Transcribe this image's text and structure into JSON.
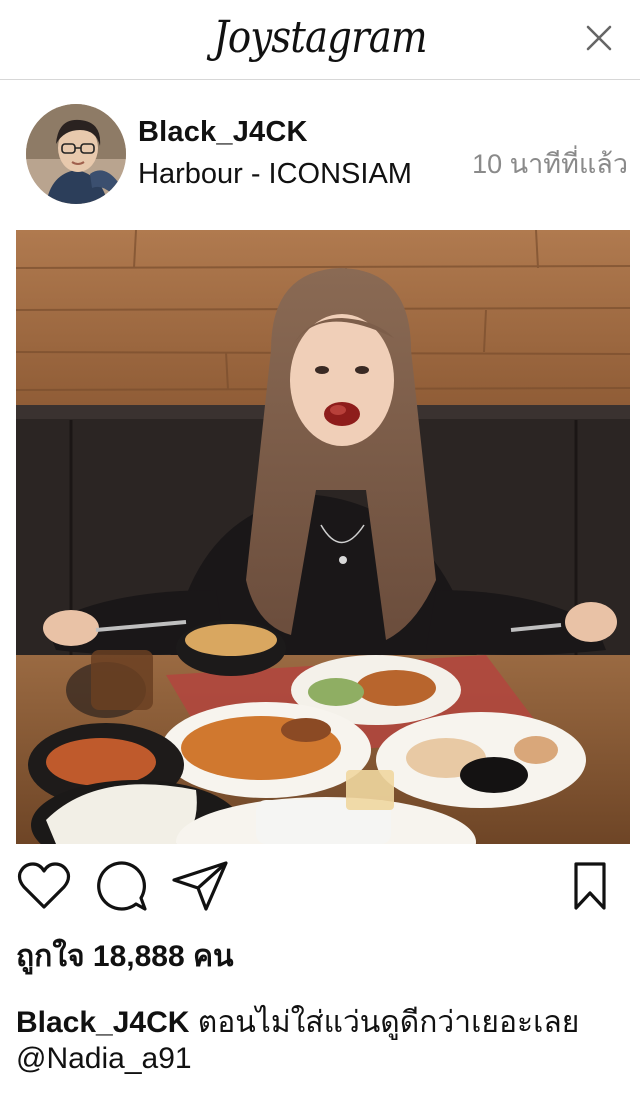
{
  "app": {
    "title": "Joystagram"
  },
  "header": {
    "close_icon": "close-icon"
  },
  "post": {
    "username": "Black_J4CK",
    "location": "Harbour - ICONSIAM",
    "time_ago": "10 นาทีที่แล้ว",
    "likes_text": "ถูกใจ 18,888 คน",
    "caption_user": "Black_J4CK",
    "caption_text": "ตอนไม่ใส่แว่นดูดีกว่าเยอะเลย",
    "mention": "@Nadia_a91"
  },
  "actions": {
    "icons": [
      "heart-icon",
      "comment-icon",
      "share-icon",
      "bookmark-icon"
    ]
  }
}
